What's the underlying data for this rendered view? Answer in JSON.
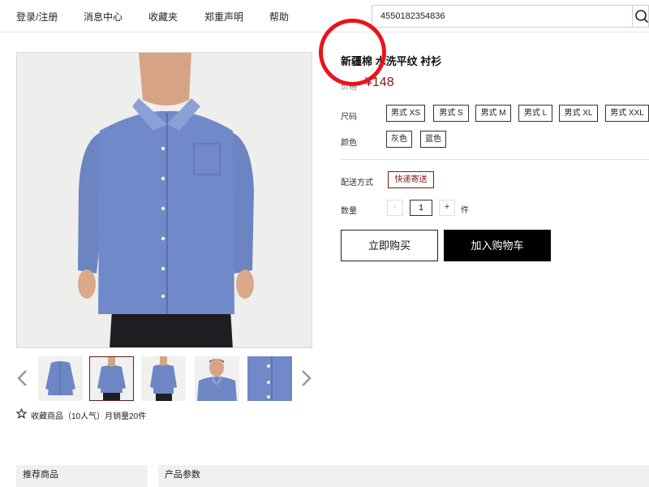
{
  "nav": {
    "items": [
      "登录/注册",
      "消息中心",
      "收藏夹",
      "郑重声明",
      "帮助"
    ]
  },
  "search": {
    "value": "4550182354836",
    "icon": "search-icon"
  },
  "product": {
    "title": "新疆棉 水洗平纹 衬衫",
    "price_label": "价格",
    "price": "¥148",
    "size_label": "尺码",
    "sizes": [
      "男式 XS",
      "男式 S",
      "男式 M",
      "男式 L",
      "男式 XL",
      "男式 XXL"
    ],
    "color_label": "颜色",
    "colors": [
      "灰色",
      "蓝色"
    ],
    "shipping_label": "配送方式",
    "shipping_option": "快递寄送",
    "quantity_label": "数量",
    "quantity_minus": "-",
    "quantity_value": "1",
    "quantity_plus": "+",
    "quantity_unit": "件",
    "buy_now": "立即购买",
    "add_to_cart": "加入购物车"
  },
  "gallery": {
    "thumb_count": 5,
    "active_index": 1,
    "fav_text": "收藏商品（10人气）月销量20件"
  },
  "bottom": {
    "recommended": "推荐商品",
    "params": "产品参数"
  },
  "colors": {
    "accent": "#7a1a1a",
    "shirt": "#6f86c4",
    "annotation": "#e8141b"
  }
}
